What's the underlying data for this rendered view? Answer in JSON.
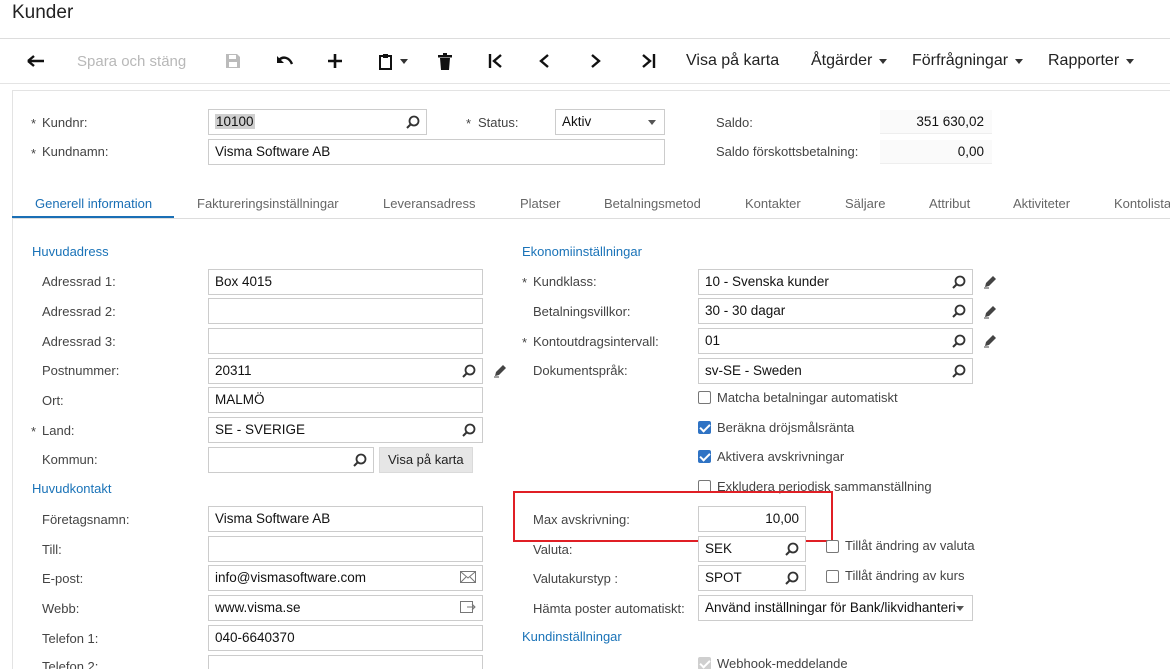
{
  "page": {
    "title": "Kunder"
  },
  "toolbar": {
    "save_close": "Spara och stäng",
    "show_map": "Visa på karta",
    "actions": "Åtgärder",
    "inquiries": "Förfrågningar",
    "reports": "Rapporter"
  },
  "header": {
    "customer_no_label": "Kundnr:",
    "customer_no": "10100",
    "status_label": "Status:",
    "status": "Aktiv",
    "customer_name_label": "Kundnamn:",
    "customer_name": "Visma Software AB",
    "balance_label": "Saldo:",
    "balance": "351 630,02",
    "prepay_balance_label": "Saldo förskottsbetalning:",
    "prepay_balance": "0,00",
    "required_mark": "*"
  },
  "tabs": [
    "Generell information",
    "Faktureringsinställningar",
    "Leveransadress",
    "Platser",
    "Betalningsmetod",
    "Kontakter",
    "Säljare",
    "Attribut",
    "Aktiviteter",
    "Kontolista"
  ],
  "main_address": {
    "section": "Huvudadress",
    "addr1_label": "Adressrad 1:",
    "addr1": "Box 4015",
    "addr2_label": "Adressrad 2:",
    "addr2": "",
    "addr3_label": "Adressrad 3:",
    "addr3": "",
    "postal_label": "Postnummer:",
    "postal": "20311",
    "city_label": "Ort:",
    "city": "MALMÖ",
    "country_label": "Land:",
    "country": "SE - SVERIGE",
    "municipality_label": "Kommun:",
    "municipality": "",
    "map_button": "Visa på karta"
  },
  "main_contact": {
    "section": "Huvudkontakt",
    "company_label": "Företagsnamn:",
    "company": "Visma Software AB",
    "attn_label": "Till:",
    "attn": "",
    "email_label": "E-post:",
    "email": "info@vismasoftware.com",
    "web_label": "Webb:",
    "web": "www.visma.se",
    "phone1_label": "Telefon 1:",
    "phone1": "040-6640370",
    "phone2_label": "Telefon 2:"
  },
  "finance": {
    "section": "Ekonomiinställningar",
    "class_label": "Kundklass:",
    "class": "10 - Svenska kunder",
    "terms_label": "Betalningsvillkor:",
    "terms": "30 - 30 dagar",
    "statement_label": "Kontoutdragsintervall:",
    "statement": "01",
    "language_label": "Dokumentspråk:",
    "language": "sv-SE - Sweden",
    "auto_match_label": "Matcha betalningar automatiskt",
    "auto_match": false,
    "late_fee_label": "Beräkna dröjsmålsränta",
    "late_fee": true,
    "writeoff_label": "Aktivera avskrivningar",
    "writeoff": true,
    "exclude_periodic_label": "Exkludera periodisk sammanställning",
    "exclude_periodic": false,
    "max_writeoff_label": "Max avskrivning:",
    "max_writeoff": "10,00",
    "currency_label": "Valuta:",
    "currency": "SEK",
    "allow_currency_label": "Tillåt ändring av valuta",
    "rate_type_label": "Valutakurstyp :",
    "rate_type": "SPOT",
    "allow_rate_label": "Tillåt ändring av kurs",
    "fetch_label": "Hämta poster automatiskt:",
    "fetch": "Använd inställningar för Bank/likvidhanteri"
  },
  "customer_settings": {
    "section": "Kundinställningar",
    "webhook_label": "Webhook-meddelande"
  },
  "colors": {
    "accent": "#1a6fb5",
    "highlight": "#e01f25",
    "checkbox": "#2f73c4"
  }
}
